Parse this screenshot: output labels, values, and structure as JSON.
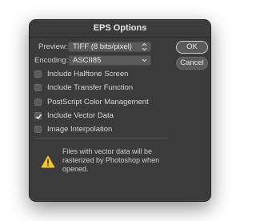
{
  "dialog": {
    "title": "EPS Options",
    "preview": {
      "label": "Preview:",
      "value": "TIFF  (8 bits/pixel)"
    },
    "encoding": {
      "label": "Encoding:",
      "value": "ASCII85"
    },
    "buttons": {
      "ok": "OK",
      "cancel": "Cancel"
    },
    "checkboxes": [
      {
        "label": "Include Halftone Screen",
        "checked": false
      },
      {
        "label": "Include Transfer Function",
        "checked": false
      },
      {
        "label": "PostScript Color Management",
        "checked": false
      },
      {
        "label": "Include Vector Data",
        "checked": true
      },
      {
        "label": "Image Interpolation",
        "checked": false
      }
    ],
    "warning": "Files with vector data will be rasterized by Photoshop when opened."
  },
  "colors": {
    "dialog_bg": "#3b3b3b",
    "control_bg": "#5a5a5a",
    "warning": "#f5c22b"
  },
  "icons": {
    "warning": "warning-triangle-icon",
    "dropdown": "chevron-updown-icon",
    "checkmark": "checkmark-icon"
  }
}
